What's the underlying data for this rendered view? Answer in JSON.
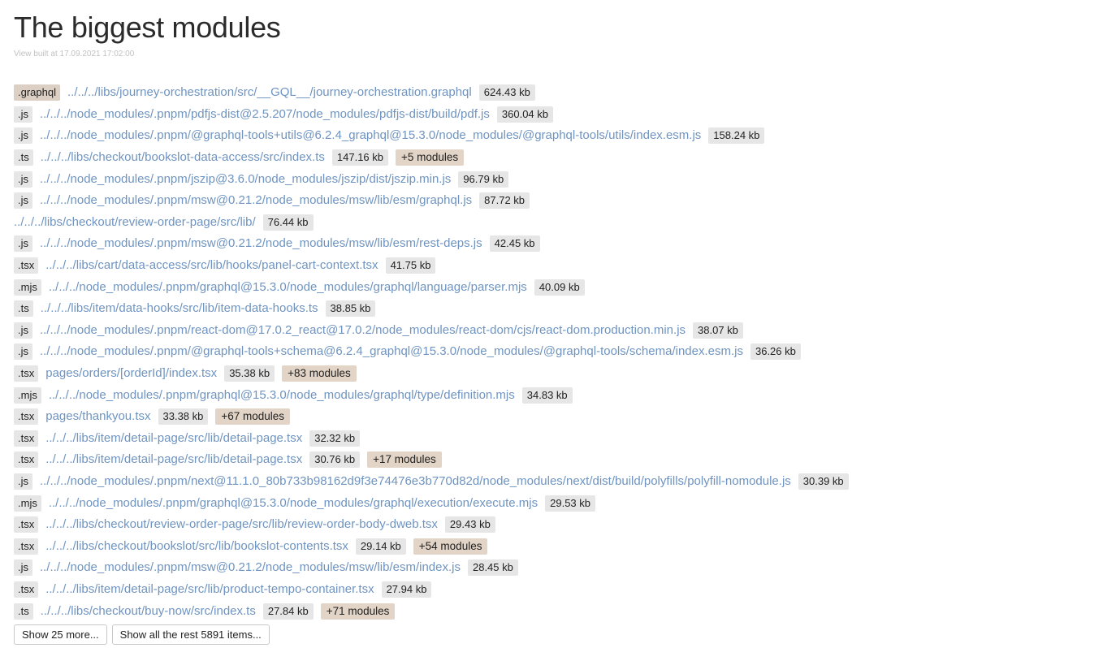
{
  "title": "The biggest modules",
  "built_text": "View built at 17.09.2021 17:02:00",
  "modules": [
    {
      "ext": ".graphql",
      "ext_kind": "graphql",
      "path": "../../../libs/journey-orchestration/src/__GQL__/journey-orchestration.graphql",
      "size": "624.43 kb",
      "extra": ""
    },
    {
      "ext": ".js",
      "ext_kind": "plain",
      "path": "../../../node_modules/.pnpm/pdfjs-dist@2.5.207/node_modules/pdfjs-dist/build/pdf.js",
      "size": "360.04 kb",
      "extra": ""
    },
    {
      "ext": ".js",
      "ext_kind": "plain",
      "path": "../../../node_modules/.pnpm/@graphql-tools+utils@6.2.4_graphql@15.3.0/node_modules/@graphql-tools/utils/index.esm.js",
      "size": "158.24 kb",
      "extra": ""
    },
    {
      "ext": ".ts",
      "ext_kind": "plain",
      "path": "../../../libs/checkout/bookslot-data-access/src/index.ts",
      "size": "147.16 kb",
      "extra": "+5 modules"
    },
    {
      "ext": ".js",
      "ext_kind": "plain",
      "path": "../../../node_modules/.pnpm/jszip@3.6.0/node_modules/jszip/dist/jszip.min.js",
      "size": "96.79 kb",
      "extra": ""
    },
    {
      "ext": ".js",
      "ext_kind": "plain",
      "path": "../../../node_modules/.pnpm/msw@0.21.2/node_modules/msw/lib/esm/graphql.js",
      "size": "87.72 kb",
      "extra": ""
    },
    {
      "ext": "",
      "ext_kind": "none",
      "path": "../../../libs/checkout/review-order-page/src/lib/",
      "size": "76.44 kb",
      "extra": ""
    },
    {
      "ext": ".js",
      "ext_kind": "plain",
      "path": "../../../node_modules/.pnpm/msw@0.21.2/node_modules/msw/lib/esm/rest-deps.js",
      "size": "42.45 kb",
      "extra": ""
    },
    {
      "ext": ".tsx",
      "ext_kind": "plain",
      "path": "../../../libs/cart/data-access/src/lib/hooks/panel-cart-context.tsx",
      "size": "41.75 kb",
      "extra": ""
    },
    {
      "ext": ".mjs",
      "ext_kind": "plain",
      "path": "../../../node_modules/.pnpm/graphql@15.3.0/node_modules/graphql/language/parser.mjs",
      "size": "40.09 kb",
      "extra": ""
    },
    {
      "ext": ".ts",
      "ext_kind": "plain",
      "path": "../../../libs/item/data-hooks/src/lib/item-data-hooks.ts",
      "size": "38.85 kb",
      "extra": ""
    },
    {
      "ext": ".js",
      "ext_kind": "plain",
      "path": "../../../node_modules/.pnpm/react-dom@17.0.2_react@17.0.2/node_modules/react-dom/cjs/react-dom.production.min.js",
      "size": "38.07 kb",
      "extra": ""
    },
    {
      "ext": ".js",
      "ext_kind": "plain",
      "path": "../../../node_modules/.pnpm/@graphql-tools+schema@6.2.4_graphql@15.3.0/node_modules/@graphql-tools/schema/index.esm.js",
      "size": "36.26 kb",
      "extra": ""
    },
    {
      "ext": ".tsx",
      "ext_kind": "plain",
      "path": "pages/orders/[orderId]/index.tsx",
      "size": "35.38 kb",
      "extra": "+83 modules"
    },
    {
      "ext": ".mjs",
      "ext_kind": "plain",
      "path": "../../../node_modules/.pnpm/graphql@15.3.0/node_modules/graphql/type/definition.mjs",
      "size": "34.83 kb",
      "extra": ""
    },
    {
      "ext": ".tsx",
      "ext_kind": "plain",
      "path": "pages/thankyou.tsx",
      "size": "33.38 kb",
      "extra": "+67 modules"
    },
    {
      "ext": ".tsx",
      "ext_kind": "plain",
      "path": "../../../libs/item/detail-page/src/lib/detail-page.tsx",
      "size": "32.32 kb",
      "extra": ""
    },
    {
      "ext": ".tsx",
      "ext_kind": "plain",
      "path": "../../../libs/item/detail-page/src/lib/detail-page.tsx",
      "size": "30.76 kb",
      "extra": "+17 modules"
    },
    {
      "ext": ".js",
      "ext_kind": "plain",
      "path": "../../../node_modules/.pnpm/next@11.1.0_80b733b98162d9f3e74476e3b770d82d/node_modules/next/dist/build/polyfills/polyfill-nomodule.js",
      "size": "30.39 kb",
      "extra": ""
    },
    {
      "ext": ".mjs",
      "ext_kind": "plain",
      "path": "../../../node_modules/.pnpm/graphql@15.3.0/node_modules/graphql/execution/execute.mjs",
      "size": "29.53 kb",
      "extra": ""
    },
    {
      "ext": ".tsx",
      "ext_kind": "plain",
      "path": "../../../libs/checkout/review-order-page/src/lib/review-order-body-dweb.tsx",
      "size": "29.43 kb",
      "extra": ""
    },
    {
      "ext": ".tsx",
      "ext_kind": "plain",
      "path": "../../../libs/checkout/bookslot/src/lib/bookslot-contents.tsx",
      "size": "29.14 kb",
      "extra": "+54 modules"
    },
    {
      "ext": ".js",
      "ext_kind": "plain",
      "path": "../../../node_modules/.pnpm/msw@0.21.2/node_modules/msw/lib/esm/index.js",
      "size": "28.45 kb",
      "extra": ""
    },
    {
      "ext": ".tsx",
      "ext_kind": "plain",
      "path": "../../../libs/item/detail-page/src/lib/product-tempo-container.tsx",
      "size": "27.94 kb",
      "extra": ""
    },
    {
      "ext": ".ts",
      "ext_kind": "plain",
      "path": "../../../libs/checkout/buy-now/src/index.ts",
      "size": "27.84 kb",
      "extra": "+71 modules"
    }
  ],
  "buttons": {
    "show_more": "Show 25 more...",
    "show_all": "Show all the rest 5891 items..."
  }
}
